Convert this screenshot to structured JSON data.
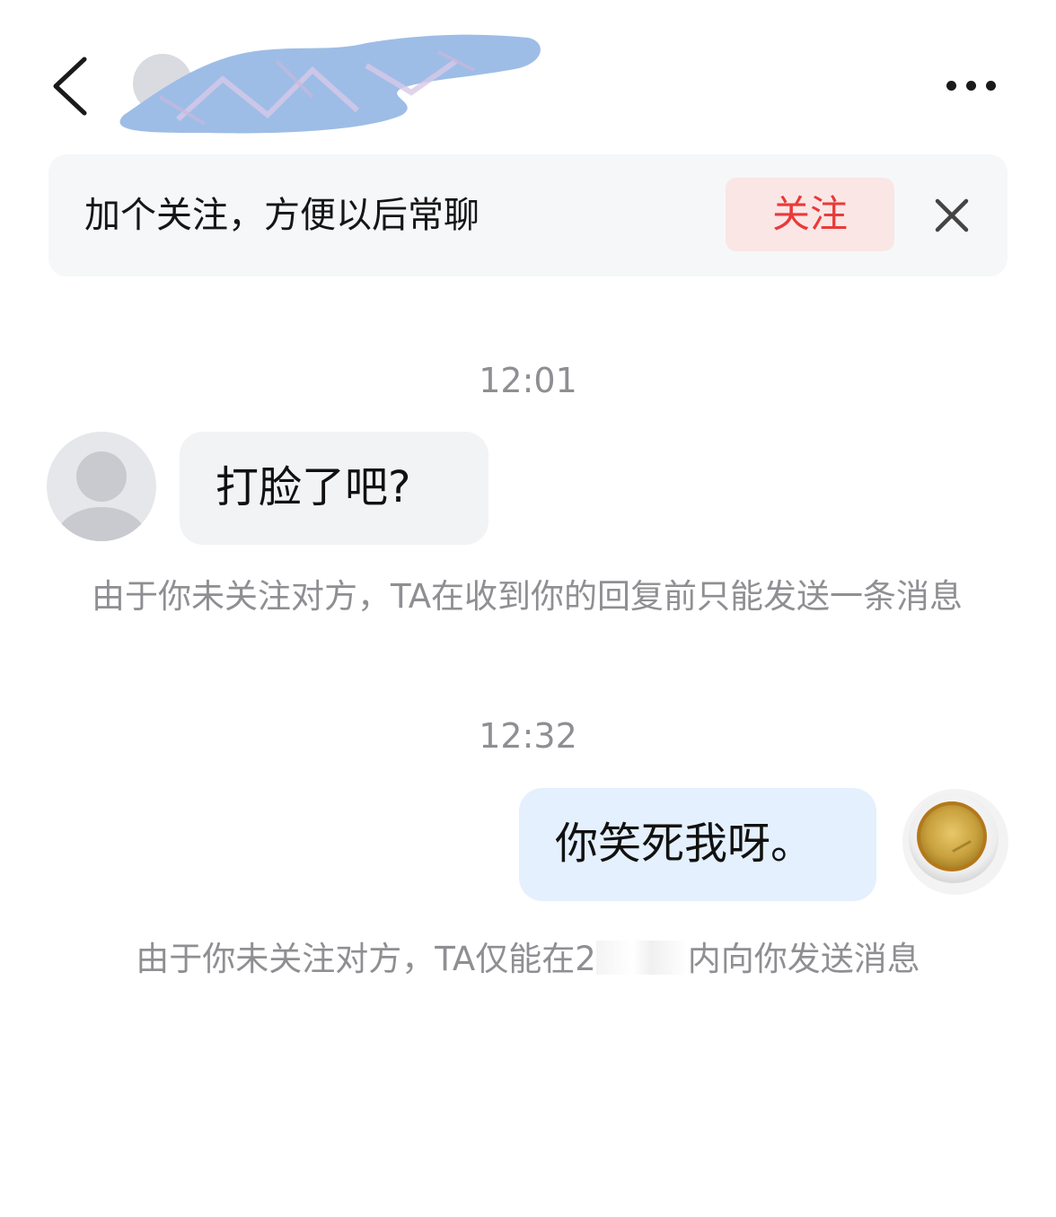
{
  "header": {
    "back_icon": "chevron-left-icon",
    "more_icon": "more-dots-icon",
    "contact_name_redacted": true
  },
  "follow_banner": {
    "text": "加个关注，方便以后常聊",
    "follow_label": "关注",
    "close_icon": "close-icon",
    "accent_color": "#e93a3a"
  },
  "messages": [
    {
      "time": "12:01",
      "direction": "incoming",
      "text": "打脸了吧?",
      "notice": "由于你未关注对方，TA在收到你的回复前只能发送一条消息"
    },
    {
      "time": "12:32",
      "direction": "outgoing",
      "text": "你笑死我呀。",
      "notice_before": "由于你未关注对方，TA仅能在2",
      "notice_after": "内向你发送消息"
    }
  ]
}
